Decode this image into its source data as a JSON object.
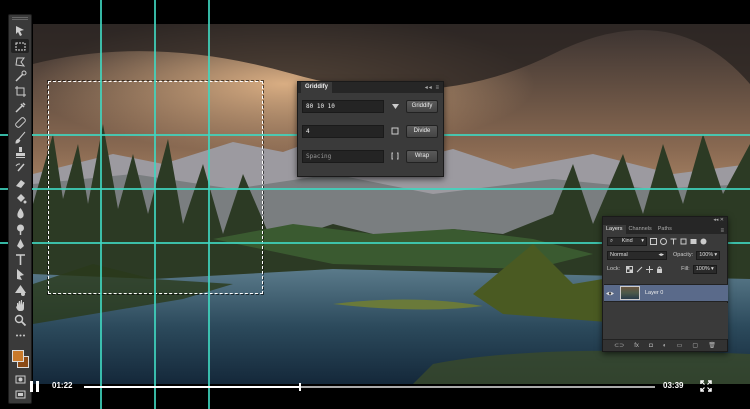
{
  "griddify": {
    "title": "Griddify",
    "controls": "◂◂ ≡",
    "grid_value": "80 10 10",
    "grid_button": "Griddify",
    "divide_value": "4",
    "divide_button": "Divide",
    "spacing_placeholder": "Spacing",
    "wrap_button": "Wrap"
  },
  "layers_panel": {
    "top_controls": "◂◂ ✕",
    "tabs": [
      "Layers",
      "Channels",
      "Paths"
    ],
    "kind_label": "Kind",
    "blend_mode": "Normal",
    "opacity_label": "Opacity:",
    "opacity_value": "100%",
    "lock_label": "Lock:",
    "fill_label": "Fill:",
    "fill_value": "100%",
    "layer_name": "Layer 0"
  },
  "video": {
    "current_time": "01:22",
    "duration": "03:39",
    "progress": 0.376
  },
  "colors": {
    "guide": "#3fd6c0",
    "foreground": "#c97a2c",
    "background": "#8a4a16",
    "selected_layer": "#5a6a8a"
  },
  "tools": [
    "move-icon",
    "marquee-icon",
    "lasso-icon",
    "quick-select-icon",
    "crop-icon",
    "eyedropper-icon",
    "healing-icon",
    "brush-icon",
    "stamp-icon",
    "history-brush-icon",
    "eraser-icon",
    "paint-bucket-icon",
    "blur-icon",
    "dodge-icon",
    "pen-icon",
    "type-icon",
    "path-select-icon",
    "shape-icon",
    "hand-icon",
    "zoom-icon"
  ]
}
